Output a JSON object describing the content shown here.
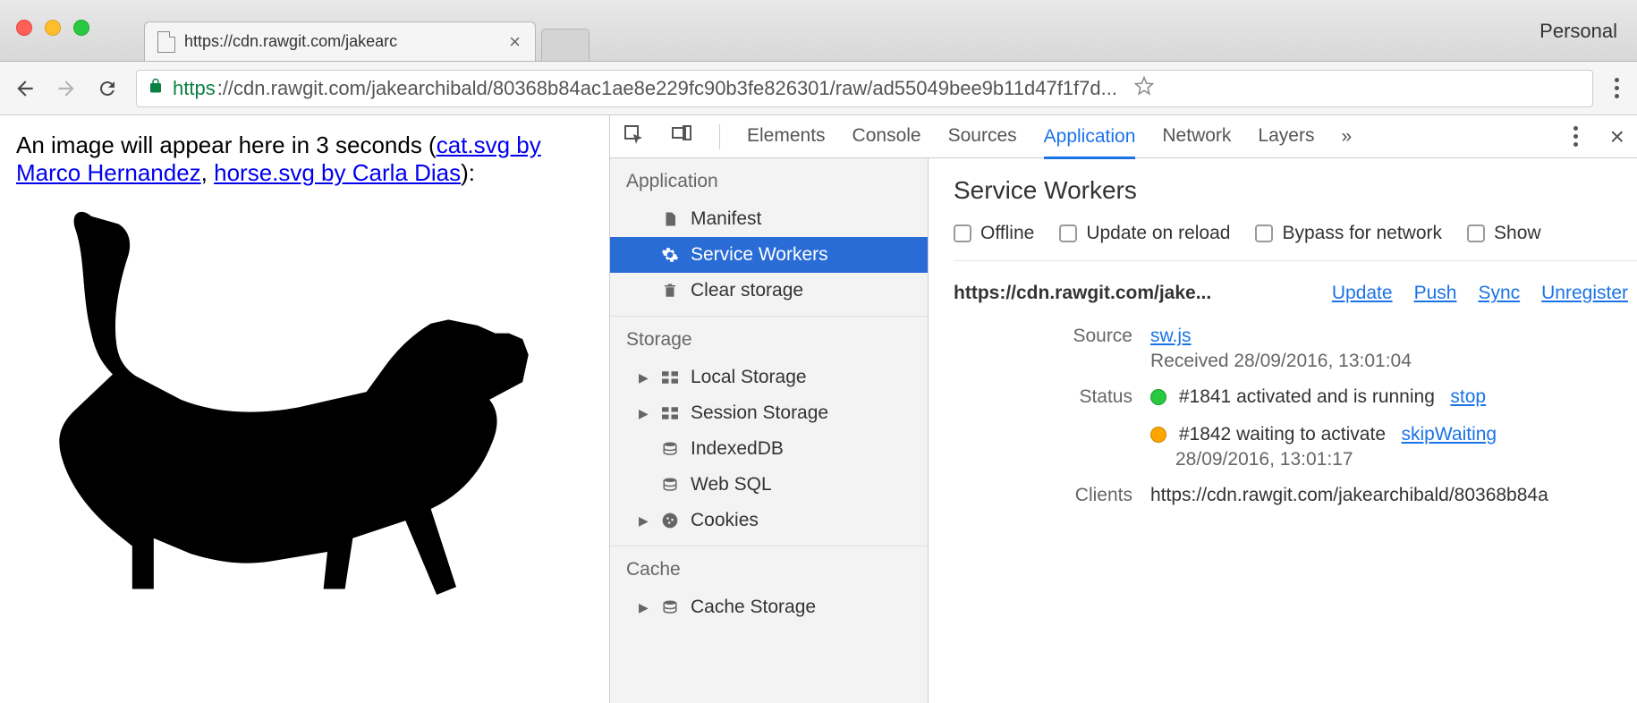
{
  "chrome": {
    "personal_label": "Personal",
    "tab_title": "https://cdn.rawgit.com/jakearc",
    "url_secure": "https",
    "url_rest": "://cdn.rawgit.com/jakearchibald/80368b84ac1ae8e229fc90b3fe826301/raw/ad55049bee9b11d47f1f7d..."
  },
  "page": {
    "text_prefix": "An image will appear here in 3 seconds (",
    "link1": "cat.svg by Marco Hernandez",
    "sep": ", ",
    "link2": "horse.svg by Carla Dias",
    "text_suffix": "):"
  },
  "devtools": {
    "tabs": [
      "Elements",
      "Console",
      "Sources",
      "Application",
      "Network",
      "Layers"
    ],
    "active_tab": "Application",
    "sidebar": {
      "sections": [
        {
          "title": "Application",
          "items": [
            {
              "label": "Manifest",
              "icon": "file"
            },
            {
              "label": "Service Workers",
              "icon": "gear",
              "selected": true
            },
            {
              "label": "Clear storage",
              "icon": "trash"
            }
          ]
        },
        {
          "title": "Storage",
          "items": [
            {
              "label": "Local Storage",
              "icon": "grid",
              "caret": true
            },
            {
              "label": "Session Storage",
              "icon": "grid",
              "caret": true
            },
            {
              "label": "IndexedDB",
              "icon": "db"
            },
            {
              "label": "Web SQL",
              "icon": "db"
            },
            {
              "label": "Cookies",
              "icon": "cookie",
              "caret": true
            }
          ]
        },
        {
          "title": "Cache",
          "items": [
            {
              "label": "Cache Storage",
              "icon": "db",
              "caret": true
            }
          ]
        }
      ]
    },
    "panel": {
      "title": "Service Workers",
      "options": [
        "Offline",
        "Update on reload",
        "Bypass for network",
        "Show"
      ],
      "origin": "https://cdn.rawgit.com/jake...",
      "actions": [
        "Update",
        "Push",
        "Sync",
        "Unregister"
      ],
      "rows": {
        "source_label": "Source",
        "source_link": "sw.js",
        "source_received": "Received 28/09/2016, 13:01:04",
        "status_label": "Status",
        "status_1_text": "#1841 activated and is running",
        "status_1_action": "stop",
        "status_2_text": "#1842 waiting to activate",
        "status_2_action": "skipWaiting",
        "status_2_time": "28/09/2016, 13:01:17",
        "clients_label": "Clients",
        "clients_value": "https://cdn.rawgit.com/jakearchibald/80368b84a"
      }
    }
  }
}
